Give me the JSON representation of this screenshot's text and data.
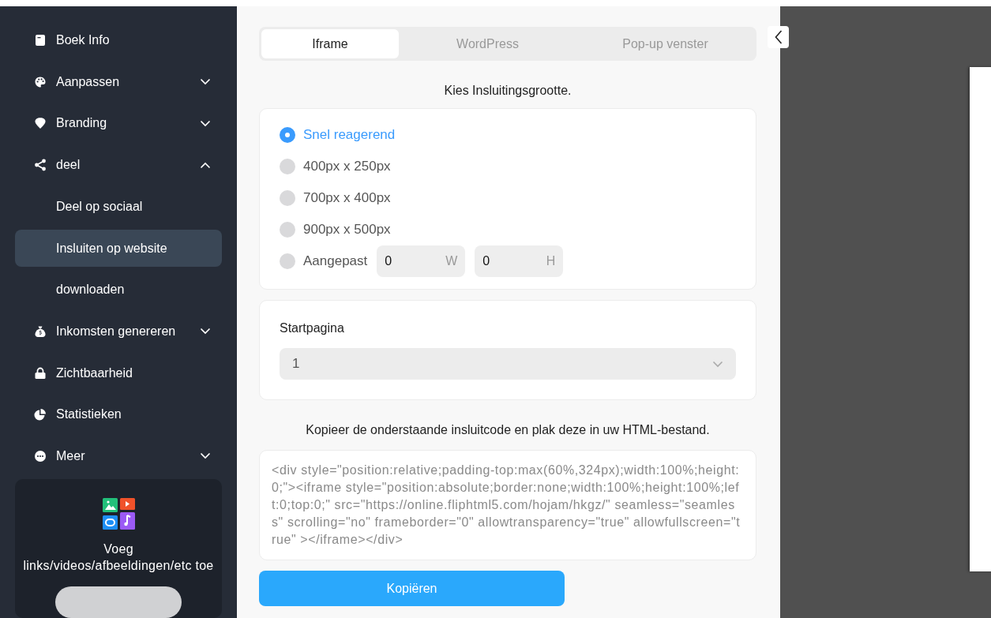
{
  "sidebar": {
    "items": [
      {
        "label": "Boek Info",
        "selected": false
      },
      {
        "label": "Aanpassen",
        "expanded": false,
        "selected": false
      },
      {
        "label": "Branding",
        "expanded": false,
        "selected": false
      },
      {
        "label": "deel",
        "expanded": true,
        "selected": false,
        "children": [
          {
            "label": "Deel op sociaal",
            "selected": false
          },
          {
            "label": "Insluiten op website",
            "selected": true
          },
          {
            "label": "downloaden",
            "selected": false
          }
        ]
      },
      {
        "label": "Inkomsten genereren",
        "expanded": false,
        "selected": false
      },
      {
        "label": "Zichtbaarheid",
        "selected": false
      },
      {
        "label": "Statistieken",
        "selected": false
      },
      {
        "label": "Meer",
        "expanded": false,
        "selected": false
      }
    ],
    "promo": {
      "text": "Voeg links/videos/afbeeldingen/etc toe"
    }
  },
  "tabs": [
    {
      "label": "Iframe",
      "selected": true
    },
    {
      "label": "WordPress",
      "selected": false
    },
    {
      "label": "Pop-up venster",
      "selected": false
    }
  ],
  "size_heading": "Kies Insluitingsgrootte.",
  "size_options": [
    {
      "kind": "preset",
      "label": "Snel reagerend",
      "selected": true
    },
    {
      "kind": "preset",
      "label": "400px x 250px",
      "selected": false
    },
    {
      "kind": "preset",
      "label": "700px x 400px",
      "selected": false
    },
    {
      "kind": "preset",
      "label": "900px x 500px",
      "selected": false
    },
    {
      "kind": "custom",
      "label": "Aangepast",
      "selected": false,
      "fields": [
        {
          "value": "0",
          "unit": "W"
        },
        {
          "value": "0",
          "unit": "H"
        }
      ]
    }
  ],
  "start_page": {
    "label": "Startpagina",
    "value": "1"
  },
  "code_heading": "Kopieer de onderstaande insluitcode en plak deze in uw HTML-bestand.",
  "embed_code": "<div style=\"position:relative;padding-top:max(60%,324px);width:100%;height:0;\"><iframe style=\"position:absolute;border:none;width:100%;height:100%;left:0;top:0;\" src=\"https://online.fliphtml5.com/hojam/hkgz/\" seamless=\"seamless\" scrolling=\"no\" frameborder=\"0\" allowtransparency=\"true\" allowfullscreen=\"true\" ></iframe></div>",
  "copy_button": "Kopiëren"
}
